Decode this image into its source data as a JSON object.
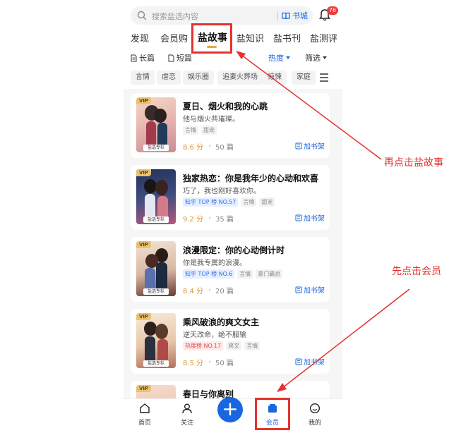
{
  "header": {
    "search_placeholder": "搜索盐选内容",
    "bookstore_label": "书城",
    "notification_count": "76"
  },
  "tabs": [
    {
      "label": "发现"
    },
    {
      "label": "会员购"
    },
    {
      "label": "盐故事",
      "active": true
    },
    {
      "label": "盐知识"
    },
    {
      "label": "盐书刊"
    },
    {
      "label": "盐测评"
    }
  ],
  "filters": {
    "long": "长篇",
    "short": "短篇",
    "sort": "热度",
    "filter": "筛选"
  },
  "chips": [
    "言情",
    "虐恋",
    "娱乐圈",
    "追妻火葬场",
    "惊悚",
    "家庭"
  ],
  "cards": [
    {
      "title": "夏日、烟火和我的心跳",
      "desc": "他与烟火共璀璨。",
      "tags": [
        {
          "text": "言情",
          "kind": "plain"
        },
        {
          "text": "甜宠",
          "kind": "plain"
        }
      ],
      "score": "8.6 分",
      "count": "50 篇",
      "vip": "VIP",
      "cover_tag": "盐选专栏",
      "add_label": "加书架"
    },
    {
      "title": "独家热恋：你是我年少的心动和欢喜",
      "desc": "巧了，我也刚好喜欢你。",
      "tags": [
        {
          "text": "知乎 TOP 榜 NO.57",
          "kind": "rank-blue"
        },
        {
          "text": "言情",
          "kind": "plain"
        },
        {
          "text": "甜宠",
          "kind": "plain"
        }
      ],
      "score": "9.2 分",
      "count": "35 篇",
      "vip": "VIP",
      "cover_tag": "盐选专栏",
      "add_label": "加书架"
    },
    {
      "title": "浪漫限定：你的心动倒计时",
      "desc": "你是我专属的浪漫。",
      "tags": [
        {
          "text": "知乎 TOP 榜 NO.6",
          "kind": "rank-blue"
        },
        {
          "text": "言情",
          "kind": "plain"
        },
        {
          "text": "豪门霸总",
          "kind": "plain"
        }
      ],
      "score": "8.4 分",
      "count": "20 篇",
      "vip": "VIP",
      "cover_tag": "盐选专栏",
      "add_label": "加书架"
    },
    {
      "title": "乘风破浪的爽文女主",
      "desc": "逆天改命，绝不服输",
      "tags": [
        {
          "text": "热度榜 NO.17",
          "kind": "rank-red"
        },
        {
          "text": "爽文",
          "kind": "plain"
        },
        {
          "text": "言情",
          "kind": "plain"
        }
      ],
      "score": "8.5 分",
      "count": "50 篇",
      "vip": "VIP",
      "cover_tag": "盐选专栏",
      "add_label": "加书架"
    },
    {
      "title": "春日与你离别",
      "vip": "VIP"
    }
  ],
  "bottom_nav": [
    {
      "label": "首页",
      "icon": "home-icon"
    },
    {
      "label": "关注",
      "icon": "follow-icon"
    },
    {
      "label": "会员",
      "icon": "member-icon",
      "active": true
    },
    {
      "label": "我的",
      "icon": "profile-icon"
    }
  ],
  "annotations": {
    "step2": "再点击盐故事",
    "step1": "先点击会员"
  },
  "colors": {
    "accent_blue": "#1a66e0",
    "annotation_red": "#e5322d",
    "score_gold": "#d8962f",
    "vip_gold": "#e7c273"
  }
}
